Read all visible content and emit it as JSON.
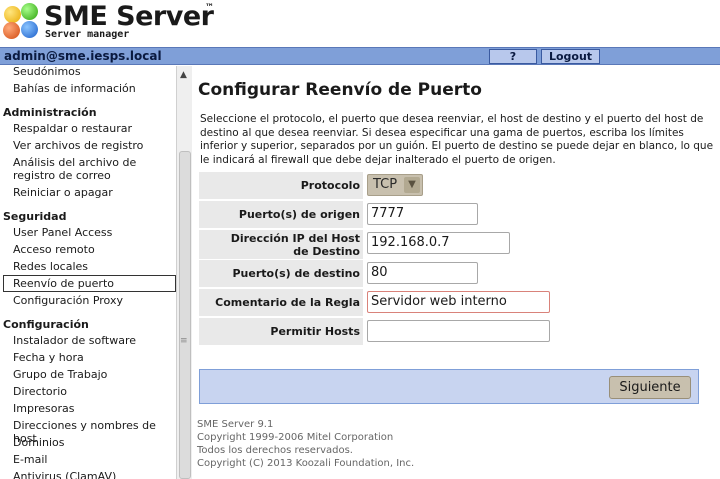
{
  "header": {
    "title": "SME Server",
    "trademark": "™",
    "subtitle": "Server manager"
  },
  "userbar": {
    "user": "admin@sme.iesps.local",
    "help_label": "?",
    "logout_label": "Logout"
  },
  "nav": {
    "top_items": [
      "Seudónimos",
      "Bahías de información"
    ],
    "sections": [
      {
        "title": "Administración",
        "items": [
          "Respaldar o restaurar",
          "Ver archivos de registro",
          "Análisis del archivo de registro de correo",
          "Reiniciar o apagar"
        ]
      },
      {
        "title": "Seguridad",
        "items": [
          "User Panel Access",
          "Acceso remoto",
          "Redes locales",
          "Reenvío de puerto",
          "Configuración Proxy"
        ]
      },
      {
        "title": "Configuración",
        "items": [
          "Instalador de software",
          "Fecha y hora",
          "Grupo de Trabajo",
          "Directorio",
          "Impresoras",
          "Direcciones y nombres de host",
          "Dominios",
          "E-mail",
          "Antivirus (ClamAV)"
        ]
      }
    ],
    "selected": "Reenvío de puerto"
  },
  "main": {
    "title": "Configurar Reenvío de Puerto",
    "description": "Seleccione el protocolo, el puerto que desea reenviar, el host de destino y el puerto del host de destino al que desea reenviar. Si desea especificar una gama de puertos, escriba los límites inferior y superior, separados por un guión. El puerto de destino se puede dejar en blanco, lo que le indicará al firewall que debe dejar inalterado el puerto de origen.",
    "form": {
      "protocol_label": "Protocolo",
      "protocol_value": "TCP",
      "source_port_label": "Puerto(s) de origen",
      "source_port_value": "7777",
      "dest_ip_label": "Dirección IP del Host de Destino",
      "dest_ip_value": "192.168.0.7",
      "dest_port_label": "Puerto(s) de destino",
      "dest_port_value": "80",
      "comment_label": "Comentario de la Regla",
      "comment_value": "Servidor web interno",
      "allow_hosts_label": "Permitir Hosts",
      "allow_hosts_value": ""
    },
    "submit_label": "Siguiente"
  },
  "footer": {
    "version": "SME Server 9.1",
    "copyright1": "Copyright 1999-2006 Mitel Corporation",
    "rights": "Todos los derechos reservados.",
    "copyright2": "Copyright (C) 2013 Koozali Foundation, Inc."
  }
}
